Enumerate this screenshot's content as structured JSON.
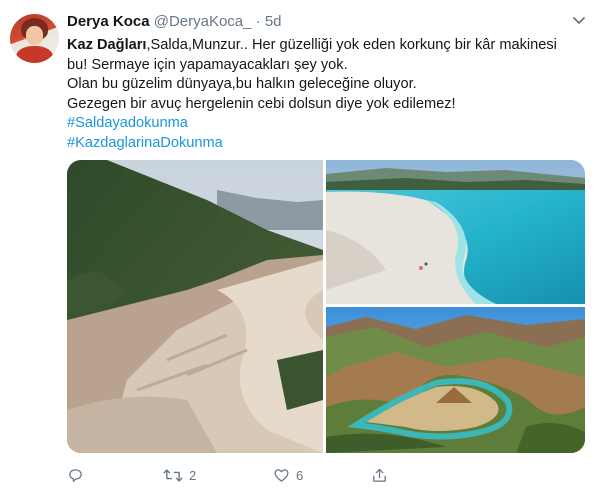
{
  "tweet": {
    "author_name": "Derya Koca",
    "handle": "@DeryaKoca_",
    "separator": "·",
    "time": "5d",
    "text": {
      "line1_bold": "Kaz Dağları",
      "line1_rest": ",Salda,Munzur..  Her güzelliği yok eden korkunç bir kâr makinesi",
      "line2": "bu! Sermaye  için yapamayacakları şey yok.",
      "line3": "Olan bu güzelim dünyaya,bu halkın geleceğine oluyor.",
      "line4": "Gezegen bir avuç hergelenin cebi dolsun diye yok edilemez!"
    },
    "hashtags": [
      "#Saldayadokunma",
      "#KazdaglarinaDokunma"
    ]
  },
  "actions": {
    "reply_count": "",
    "retweet_count": "2",
    "like_count": "6"
  },
  "icons": {
    "avatar": "profile-photo",
    "chevron": "chevron-down-icon",
    "reply": "reply-icon",
    "retweet": "retweet-icon",
    "like": "heart-icon",
    "share": "share-icon"
  },
  "colors": {
    "text": "#14171a",
    "secondary": "#657786",
    "link": "#1b95e0"
  }
}
